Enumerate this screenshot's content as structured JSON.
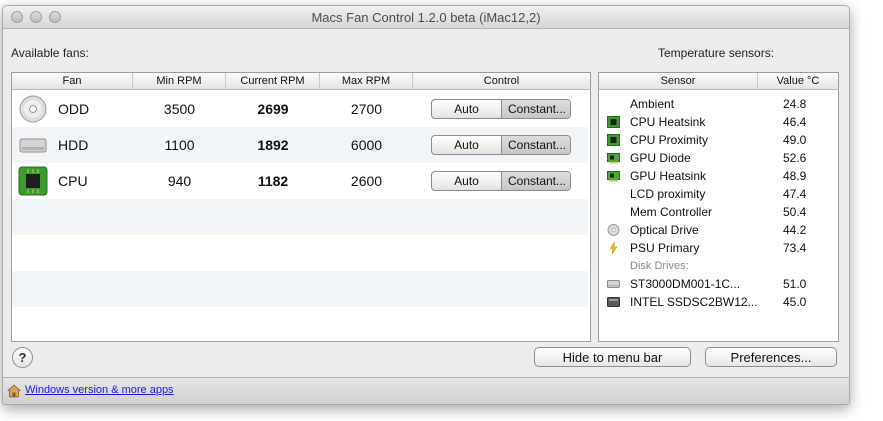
{
  "window": {
    "title": "Macs Fan Control 1.2.0 beta (iMac12,2)"
  },
  "fans_section": {
    "label": "Available fans:",
    "columns": [
      "Fan",
      "Min RPM",
      "Current RPM",
      "Max RPM",
      "Control"
    ],
    "rows": [
      {
        "name": "ODD",
        "icon": "optical-drive-icon",
        "min": "3500",
        "current": "2699",
        "max": "2700",
        "auto": "Auto",
        "constant": "Constant..."
      },
      {
        "name": "HDD",
        "icon": "hard-drive-icon",
        "min": "1100",
        "current": "1892",
        "max": "6000",
        "auto": "Auto",
        "constant": "Constant..."
      },
      {
        "name": "CPU",
        "icon": "cpu-chip-icon",
        "min": "940",
        "current": "1182",
        "max": "2600",
        "auto": "Auto",
        "constant": "Constant..."
      }
    ]
  },
  "sensors_section": {
    "label": "Temperature sensors:",
    "columns": [
      "Sensor",
      "Value °C"
    ],
    "rows": [
      {
        "name": "Ambient",
        "value": "24.8",
        "icon": ""
      },
      {
        "name": "CPU Heatsink",
        "value": "46.4",
        "icon": "cpu-chip-icon"
      },
      {
        "name": "CPU Proximity",
        "value": "49.0",
        "icon": "cpu-chip-icon"
      },
      {
        "name": "GPU Diode",
        "value": "52.6",
        "icon": "gpu-card-icon"
      },
      {
        "name": "GPU Heatsink",
        "value": "48.9",
        "icon": "gpu-card-icon"
      },
      {
        "name": "LCD proximity",
        "value": "47.4",
        "icon": ""
      },
      {
        "name": "Mem Controller",
        "value": "50.4",
        "icon": ""
      },
      {
        "name": "Optical Drive",
        "value": "44.2",
        "icon": "optical-drive-icon"
      },
      {
        "name": "PSU Primary",
        "value": "73.4",
        "icon": "lightning-icon"
      }
    ],
    "group_label": "Disk Drives:",
    "disks": [
      {
        "name": "ST3000DM001-1C...",
        "value": "51.0",
        "icon": "hard-drive-icon"
      },
      {
        "name": "INTEL SSDSC2BW12...",
        "value": "45.0",
        "icon": "ssd-drive-icon"
      }
    ]
  },
  "buttons": {
    "help": "?",
    "hide": "Hide to menu bar",
    "preferences": "Preferences..."
  },
  "footer": {
    "link": "Windows version & more apps"
  }
}
